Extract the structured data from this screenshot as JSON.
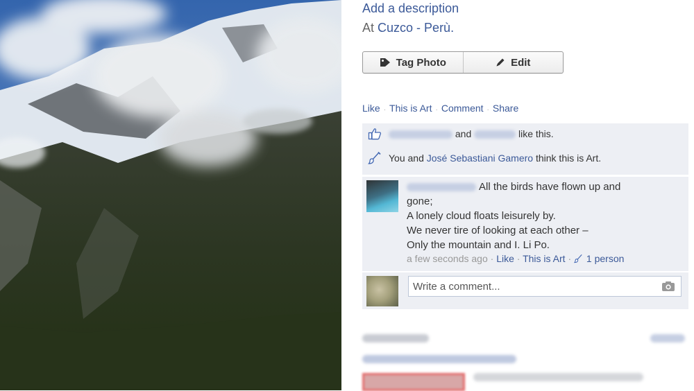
{
  "photo": {
    "icon": "mountain-photo"
  },
  "info": {
    "description_link": "Add a description",
    "location_prefix": "At",
    "location_name": "Cuzco - Perù."
  },
  "buttons": {
    "tag_photo": "Tag Photo",
    "edit": "Edit"
  },
  "actions": {
    "like": "Like",
    "art": "This is Art",
    "comment": "Comment",
    "share": "Share"
  },
  "likes": {
    "connector": "and",
    "suffix": "like this.",
    "art_you": "You and",
    "art_person": "José Sebastiani Gamero",
    "art_suffix": "think this is Art."
  },
  "comment": {
    "lines": [
      "All the birds have flown up and",
      "gone;",
      "A lonely cloud floats leisurely by.",
      "We never tire of looking at each other –",
      "Only the mountain and I. Li Po."
    ],
    "time": "a few seconds ago",
    "like": "Like",
    "art": "This is Art",
    "count": "1 person"
  },
  "composer": {
    "placeholder": "Write a comment..."
  },
  "colors": {
    "link": "#3b5998",
    "panel_bg": "#edeff4",
    "border": "#bdc7d8"
  }
}
